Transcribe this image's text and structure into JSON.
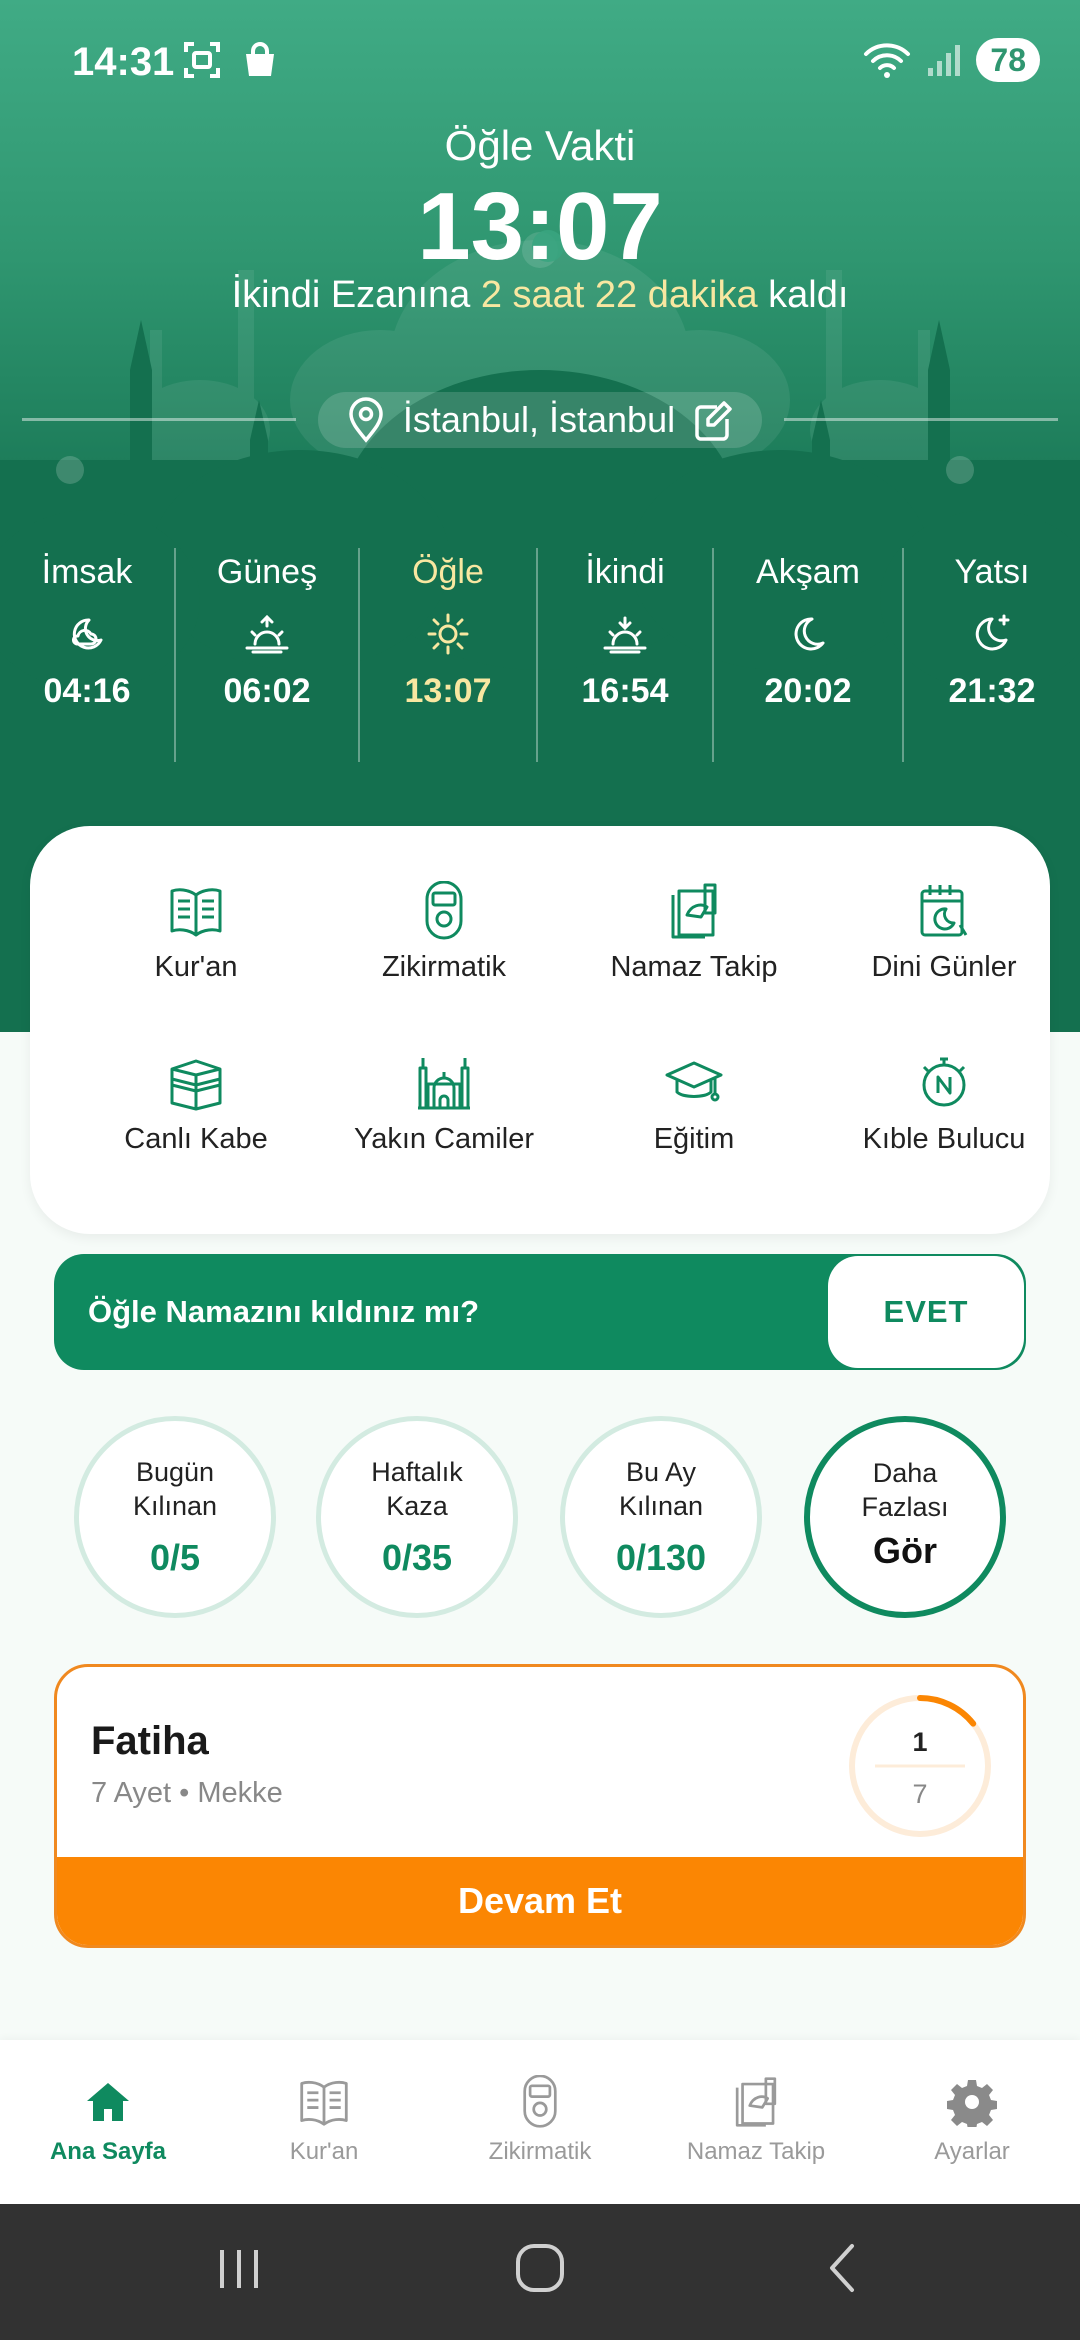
{
  "status_bar": {
    "time": "14:31",
    "battery": "78",
    "icons": [
      "screenshot-icon",
      "shopping-bag-icon",
      "wifi-icon",
      "signal-icon"
    ]
  },
  "header": {
    "current_prayer_label": "Öğle Vakti",
    "current_prayer_time": "13:07",
    "countdown_prefix": "İkindi Ezanına",
    "countdown_highlight": "2 saat 22 dakika",
    "countdown_suffix": "kaldı",
    "location": "İstanbul, İstanbul"
  },
  "prayer_times": [
    {
      "name": "İmsak",
      "time": "04:16",
      "icon": "moon-cloud-icon",
      "active": false
    },
    {
      "name": "Güneş",
      "time": "06:02",
      "icon": "sunrise-icon",
      "active": false
    },
    {
      "name": "Öğle",
      "time": "13:07",
      "icon": "sun-icon",
      "active": true
    },
    {
      "name": "İkindi",
      "time": "16:54",
      "icon": "sunset-icon",
      "active": false
    },
    {
      "name": "Akşam",
      "time": "20:02",
      "icon": "moon-icon",
      "active": false
    },
    {
      "name": "Yatsı",
      "time": "21:32",
      "icon": "moon-star-icon",
      "active": false
    }
  ],
  "menu": [
    {
      "label": "Kur'an",
      "icon": "book-icon"
    },
    {
      "label": "Zikirmatik",
      "icon": "counter-icon"
    },
    {
      "label": "Namaz Takip",
      "icon": "prayer-tracker-icon"
    },
    {
      "label": "Dini Günler",
      "icon": "calendar-icon"
    },
    {
      "label": "Canlı Kabe",
      "icon": "kaaba-icon"
    },
    {
      "label": "Yakın Camiler",
      "icon": "mosque-icon"
    },
    {
      "label": "Eğitim",
      "icon": "graduation-cap-icon"
    },
    {
      "label": "Kıble Bulucu",
      "icon": "compass-icon"
    }
  ],
  "question": {
    "text": "Öğle Namazını kıldınız mı?",
    "button": "EVET"
  },
  "stats": [
    {
      "label": "Bugün Kılınan",
      "value": "0/5"
    },
    {
      "label": "Haftalık Kaza",
      "value": "0/35"
    },
    {
      "label": "Bu Ay Kılınan",
      "value": "0/130"
    },
    {
      "label": "Daha Fazlası",
      "value": "Gör"
    }
  ],
  "quran_card": {
    "title": "Fatiha",
    "subtitle": "7 Ayet • Mekke",
    "progress_current": "1",
    "progress_total": "7",
    "progress_fraction": 0.142857,
    "button": "Devam Et"
  },
  "bottom_nav": [
    {
      "label": "Ana Sayfa",
      "icon": "home-icon",
      "active": true
    },
    {
      "label": "Kur'an",
      "icon": "book-icon",
      "active": false
    },
    {
      "label": "Zikirmatik",
      "icon": "counter-icon",
      "active": false
    },
    {
      "label": "Namaz Takip",
      "icon": "prayer-tracker-icon",
      "active": false
    },
    {
      "label": "Ayarlar",
      "icon": "gear-icon",
      "active": false
    }
  ],
  "colors": {
    "primary": "#0f8a5f",
    "header_top": "#40ab85",
    "header_bottom": "#116b4b",
    "highlight": "#f8e7a1",
    "accent_orange": "#fb8603"
  }
}
